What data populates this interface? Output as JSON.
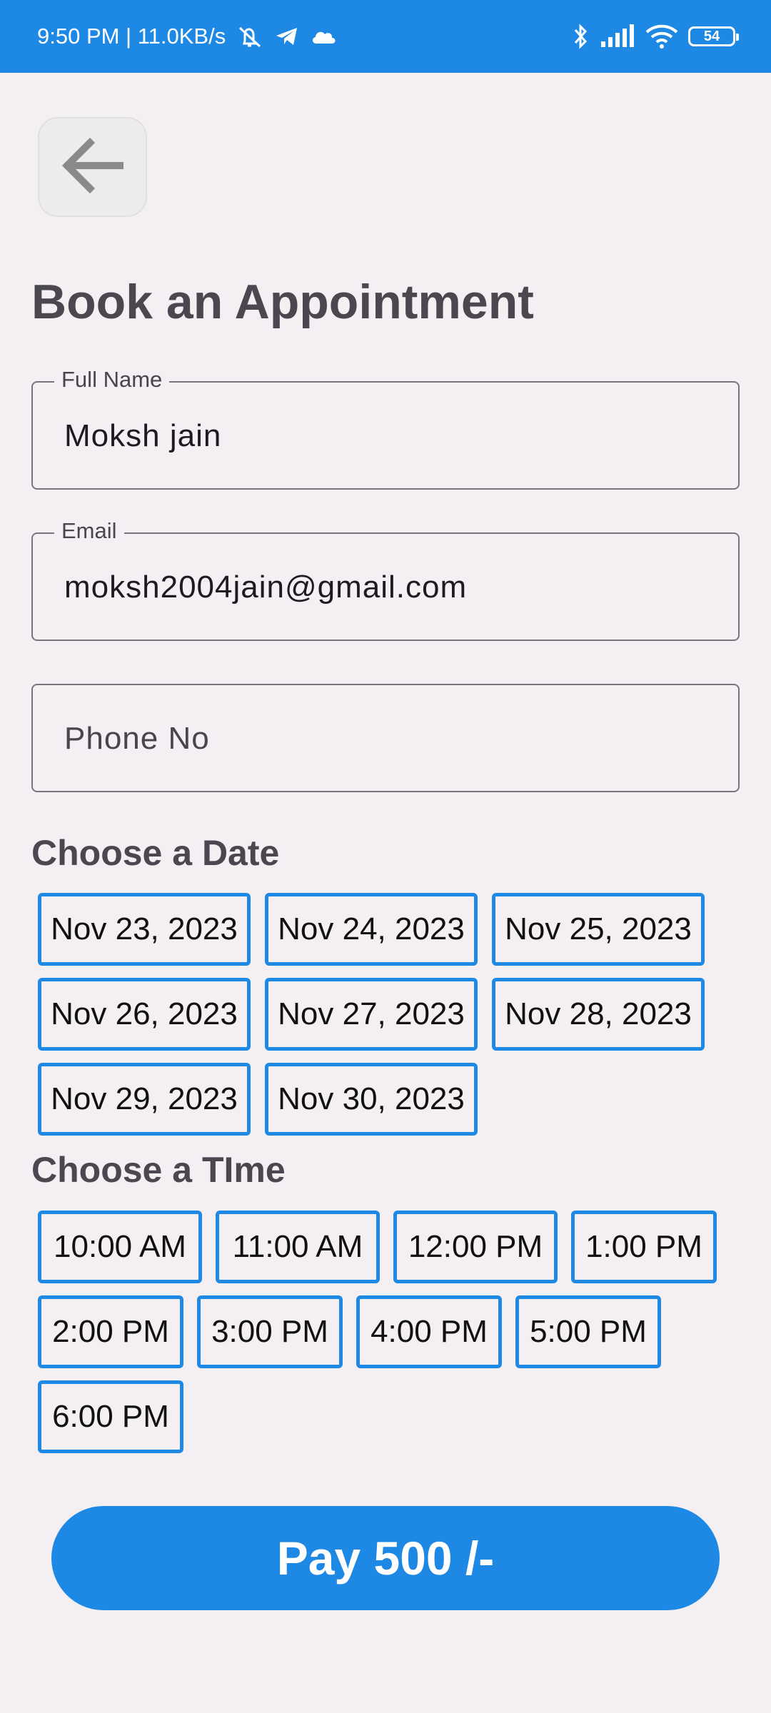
{
  "status_bar": {
    "time_speed": "9:50 PM | 11.0KB/s",
    "battery": "54",
    "icons": [
      "mute-icon",
      "telegram-icon",
      "cloud-icon",
      "bluetooth-icon",
      "signal-icon",
      "wifi-icon",
      "battery-icon"
    ]
  },
  "colors": {
    "accent": "#1e88e5",
    "background": "#f3eff3",
    "title_text": "#4a4750"
  },
  "header": {
    "back_icon": "arrow-left-icon",
    "title": "Book an Appointment"
  },
  "form": {
    "full_name": {
      "label": "Full Name",
      "value": "Moksh jain"
    },
    "email": {
      "label": "Email",
      "value": "moksh2004jain@gmail.com"
    },
    "phone": {
      "placeholder": "Phone No",
      "value": ""
    }
  },
  "date_section": {
    "title": "Choose a Date",
    "dates": [
      "Nov 23, 2023",
      "Nov 24, 2023",
      "Nov 25, 2023",
      "Nov 26, 2023",
      "Nov 27, 2023",
      "Nov 28, 2023",
      "Nov 29, 2023",
      "Nov 30, 2023"
    ]
  },
  "time_section": {
    "title": "Choose a TIme",
    "times": [
      "10:00 AM",
      "11:00 AM",
      "12:00 PM",
      "1:00 PM",
      "2:00 PM",
      "3:00 PM",
      "4:00 PM",
      "5:00 PM",
      "6:00 PM"
    ]
  },
  "pay_button": {
    "label": "Pay 500 /-"
  }
}
